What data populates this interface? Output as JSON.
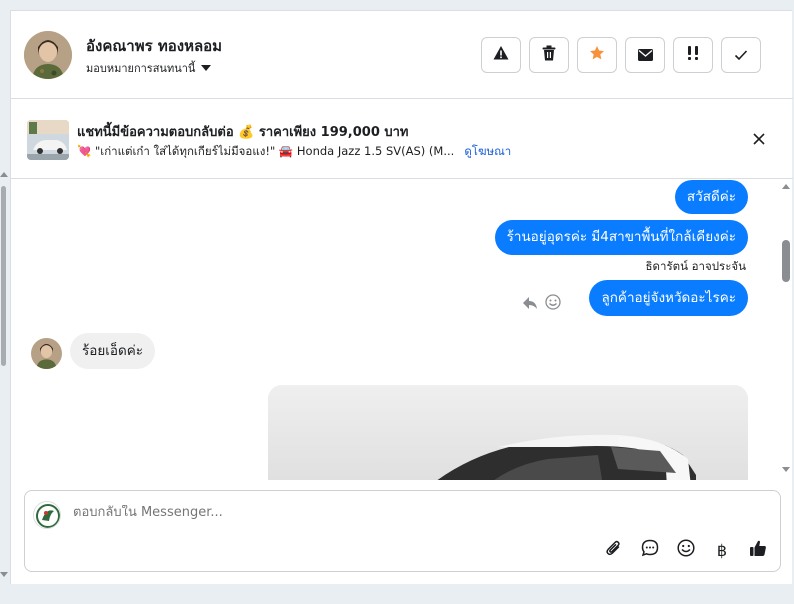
{
  "header": {
    "name": "อังคณาพร ทองหลอม",
    "assign_label": "มอบหมายการสนทนานี้",
    "actions": [
      "report-icon",
      "trash-icon",
      "star-icon",
      "mail-icon",
      "priority-icon",
      "check-icon"
    ],
    "star_color": "#f7923a"
  },
  "ad": {
    "title": "แชทนี้มีข้อความตอบกลับต่อ 💰 ราคาเพียง 199,000 บาท",
    "subtitle": "💘 \"เก่าแต่เก๋า ใส่ได้ทุกเกียร์ไม่มีจอแง!\" 🚘 Honda Jazz 1.5 SV(AS) (M...",
    "link": "ดูโฆษณา"
  },
  "messages": [
    {
      "side": "out",
      "text": "สวัสดีค่ะ"
    },
    {
      "side": "out",
      "text": "ร้านอยู่อุดรค่ะ มี4สาขาพื้นที่ใกล้เคียงค่ะ",
      "sender": "ธิดารัตน์ อาจประจัน"
    },
    {
      "side": "out",
      "text": "ลูกค้าอยู่จังหวัดอะไรคะ"
    },
    {
      "side": "in",
      "text": "ร้อยเอ็ดค่ะ"
    }
  ],
  "composer": {
    "placeholder": "ตอบกลับใน Messenger...",
    "icons": [
      "attachment-icon",
      "saved-reply-icon",
      "emoji-icon",
      "baht-icon",
      "thumbs-up-icon"
    ],
    "baht_symbol": "฿"
  },
  "colors": {
    "outgoing_bubble": "#0a7cff",
    "incoming_bubble": "#f0f0f0",
    "link": "#1a5fd8"
  }
}
